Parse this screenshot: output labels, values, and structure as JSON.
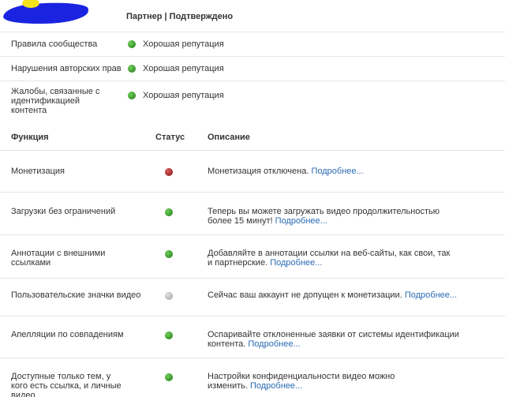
{
  "header": {
    "status_text": "Партнер | Подтверждено"
  },
  "reputation": [
    {
      "label": "Правила сообщества",
      "status": "green",
      "value": "Хорошая репутация"
    },
    {
      "label": "Нарушения авторских прав",
      "status": "green",
      "value": "Хорошая репутация"
    },
    {
      "label": "Жалобы, связанные с идентификацией контента",
      "status": "green",
      "value": "Хорошая репутация"
    }
  ],
  "table": {
    "headers": {
      "feature": "Функция",
      "status": "Статус",
      "description": "Описание"
    },
    "rows": [
      {
        "name": "Монетизация",
        "status": "red",
        "desc": "Монетизация отключена.",
        "link": "Подробнее..."
      },
      {
        "name": "Загрузки без ограничений",
        "status": "green",
        "desc": "Теперь вы можете загружать видео продолжительностью более 15 минут!",
        "link": "Подробнее..."
      },
      {
        "name": "Аннотации с внешними ссылками",
        "status": "green",
        "desc": "Добавляйте в аннотации ссылки на веб-сайты, как свои, так и партнерские.",
        "link": "Подробнее..."
      },
      {
        "name": "Пользовательские значки видео",
        "status": "gray",
        "desc": "Сейчас ваш аккаунт не допущен к монетизации.",
        "link": "Подробнее..."
      },
      {
        "name": "Апелляции по совпадениям",
        "status": "green",
        "desc": "Оспаривайте отклоненные заявки от системы идентификации контента.",
        "link": "Подробнее..."
      },
      {
        "name": "Доступные только тем, у кого есть ссылка, и личные видео",
        "status": "green",
        "desc": "Настройки конфиденциальности видео можно изменить.",
        "link": "Подробнее..."
      }
    ]
  },
  "colors": {
    "green": "#3f9a30",
    "red": "#a92b2b",
    "gray": "#b8b8b8",
    "link": "#2a6bb3"
  }
}
